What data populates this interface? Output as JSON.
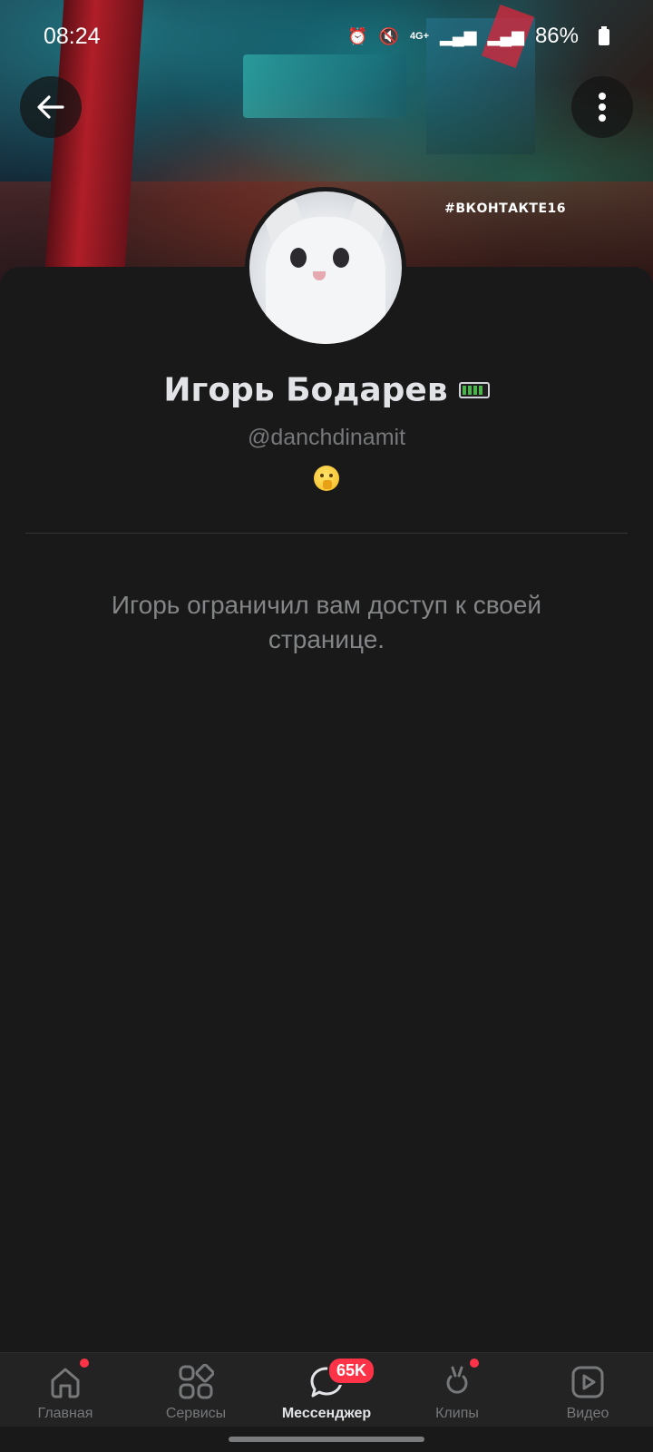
{
  "status_bar": {
    "time": "08:24",
    "network": "4G+",
    "battery": "86%"
  },
  "cover": {
    "hashtag": "#ВКОНТАКТЕ16"
  },
  "profile": {
    "name": "Игорь Бодарев",
    "handle": "@danchdinamit",
    "status_emoji": "shushing-face-emoji",
    "restriction_message": "Игорь ограничил вам доступ к своей странице."
  },
  "tabbar": {
    "tabs": [
      {
        "label": "Главная",
        "icon": "home-icon",
        "has_dot": true
      },
      {
        "label": "Сервисы",
        "icon": "services-icon",
        "has_dot": false
      },
      {
        "label": "Мессенджер",
        "icon": "messenger-icon",
        "active": true,
        "badge": "65K"
      },
      {
        "label": "Клипы",
        "icon": "clips-icon",
        "has_dot": true
      },
      {
        "label": "Видео",
        "icon": "video-icon",
        "has_dot": false
      }
    ]
  },
  "colors": {
    "background": "#19191a",
    "accent_red": "#ff3347",
    "text_primary": "#e1e3e6",
    "text_secondary": "#76787a"
  }
}
